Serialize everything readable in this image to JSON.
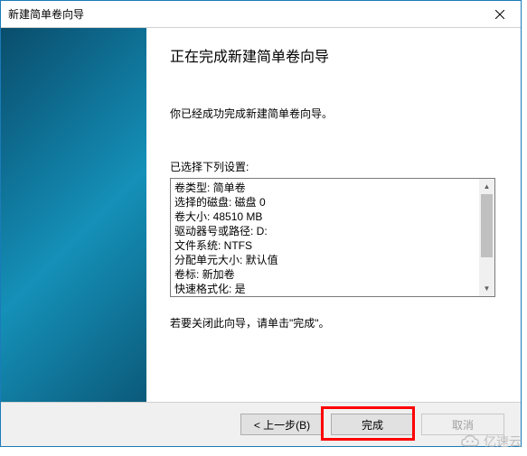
{
  "titlebar": {
    "title": "新建简单卷向导"
  },
  "content": {
    "heading": "正在完成新建简单卷向导",
    "subtext": "你已经成功完成新建简单卷向导。",
    "listlabel": "已选择下列设置:",
    "settings": {
      "l0": "卷类型: 简单卷",
      "l1": "选择的磁盘: 磁盘 0",
      "l2": "卷大小: 48510 MB",
      "l3": "驱动器号或路径: D:",
      "l4": "文件系统: NTFS",
      "l5": "分配单元大小: 默认值",
      "l6": "卷标: 新加卷",
      "l7": "快速格式化: 是"
    },
    "footnote": "若要关闭此向导，请单击\"完成\"。"
  },
  "buttons": {
    "back": "< 上一步(B)",
    "finish": "完成",
    "cancel": "取消"
  },
  "watermark": {
    "text": "亿速云"
  }
}
